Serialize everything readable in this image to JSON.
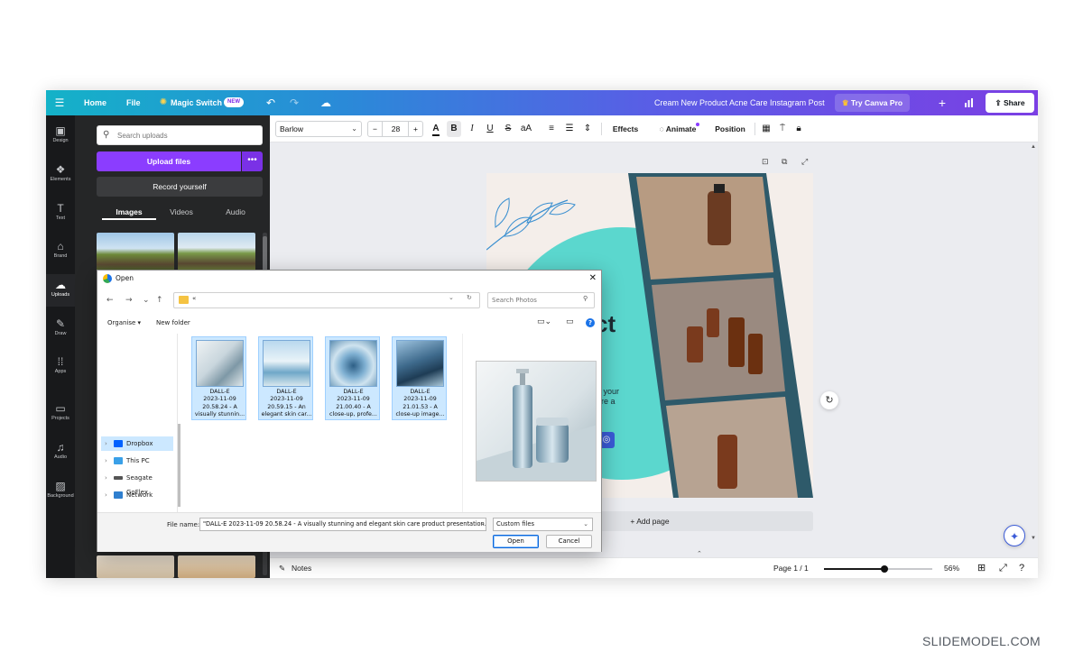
{
  "topbar": {
    "home": "Home",
    "file": "File",
    "magic_switch": "Magic Switch",
    "badge": "NEW",
    "doc_title": "Cream New Product Acne Care Instagram Post",
    "try_pro": "Try Canva Pro",
    "share": "Share",
    "menu_icon": "hamburger-icon",
    "undo_icon": "undo-icon",
    "redo_icon": "redo-icon",
    "cloud_icon": "cloud-sync-icon",
    "add_icon": "plus-icon",
    "stats_icon": "bar-chart-icon"
  },
  "rail": {
    "items": [
      {
        "label": "Design",
        "icon": "design-icon"
      },
      {
        "label": "Elements",
        "icon": "elements-icon"
      },
      {
        "label": "Text",
        "icon": "text-icon"
      },
      {
        "label": "Brand",
        "icon": "brand-icon"
      },
      {
        "label": "Uploads",
        "icon": "upload-cloud-icon"
      },
      {
        "label": "Draw",
        "icon": "draw-icon"
      },
      {
        "label": "Apps",
        "icon": "apps-icon"
      },
      {
        "label": "Projects",
        "icon": "folder-icon"
      },
      {
        "label": "Audio",
        "icon": "music-icon"
      },
      {
        "label": "Background",
        "icon": "background-icon"
      }
    ]
  },
  "panel": {
    "search_placeholder": "Search uploads",
    "upload_files": "Upload files",
    "record": "Record yourself",
    "tabs": [
      "Images",
      "Videos",
      "Audio"
    ]
  },
  "toolbar": {
    "font": "Barlow",
    "font_size": "28",
    "minus": "−",
    "plus": "+",
    "effects": "Effects",
    "animate": "Animate",
    "position": "Position",
    "bold": "B",
    "italic": "I",
    "underline": "U",
    "strike": "S",
    "case": "aA"
  },
  "canvas": {
    "add_page": "+ Add page",
    "partial_heading": "ct",
    "partial_line1": "o your",
    "partial_line2": "are a"
  },
  "footer": {
    "notes": "Notes",
    "page": "Page 1 / 1",
    "zoom": "56%",
    "zoom_fraction": 0.56
  },
  "dialog": {
    "title": "Open",
    "address": "«",
    "search_placeholder": "Search Photos",
    "organise": "Organise ▾",
    "new_folder": "New folder",
    "nav": [
      "Dropbox",
      "This PC",
      "Seagate GoFlex",
      "Network"
    ],
    "files": [
      {
        "line1": "DALL-E",
        "line2": "2023-11-09",
        "line3": "20.58.24 - A",
        "line4": "visually stunnin..."
      },
      {
        "line1": "DALL-E",
        "line2": "2023-11-09",
        "line3": "20.59.15 - An",
        "line4": "elegant skin car..."
      },
      {
        "line1": "DALL-E",
        "line2": "2023-11-09",
        "line3": "21.00.40 - A",
        "line4": "close-up, profe..."
      },
      {
        "line1": "DALL-E",
        "line2": "2023-11-09",
        "line3": "21.01.53 - A",
        "line4": "close-up image..."
      }
    ],
    "file_name_label": "File name:",
    "file_name_value": "\"DALL-E 2023-11-09 20.58.24 - A visually stunning and elegant skin care product presentation. The",
    "filter": "Custom files",
    "open": "Open",
    "cancel": "Cancel"
  },
  "watermark": "SLIDEMODEL.COM"
}
